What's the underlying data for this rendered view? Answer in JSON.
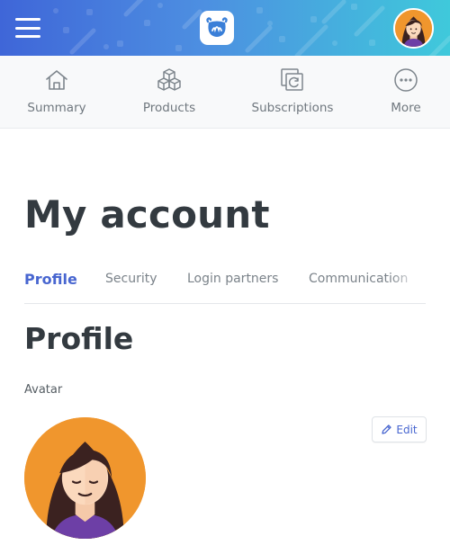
{
  "header": {
    "menu_icon": "hamburger-icon",
    "logo_icon": "cauldron-logo",
    "avatar_icon": "user-avatar"
  },
  "nav": {
    "items": [
      {
        "label": "Summary",
        "icon": "home-icon"
      },
      {
        "label": "Products",
        "icon": "cubes-icon"
      },
      {
        "label": "Subscriptions",
        "icon": "subscriptions-icon"
      },
      {
        "label": "More",
        "icon": "more-dots-icon"
      }
    ]
  },
  "page": {
    "title": "My account"
  },
  "subtabs": {
    "items": [
      "Profile",
      "Security",
      "Login partners",
      "Communication"
    ],
    "active": "Profile"
  },
  "profile": {
    "section_title": "Profile",
    "avatar_label": "Avatar",
    "edit_label": "Edit"
  },
  "colors": {
    "accent": "#4866d0",
    "header_gradient_start": "#3f66d8",
    "header_gradient_end": "#3fc9db",
    "avatar_background": "#f0962d"
  }
}
